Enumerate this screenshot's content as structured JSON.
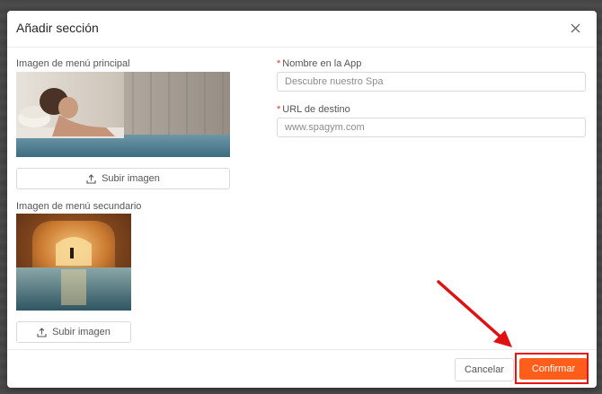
{
  "dialog": {
    "title": "Añadir sección"
  },
  "left": {
    "main_image_label": "Imagen de menú principal",
    "main_upload_label": "Subir imagen",
    "secondary_image_label": "Imagen de menú secundario",
    "secondary_upload_label": "Subir imagen"
  },
  "right": {
    "name_label": "Nombre en la App",
    "name_value": "Descubre nuestro Spa",
    "url_label": "URL de destino",
    "url_value": "www.spagym.com",
    "required_mark": "*"
  },
  "footer": {
    "cancel_label": "Cancelar",
    "confirm_label": "Confirmar"
  },
  "colors": {
    "accent": "#ff5e1a",
    "annotation": "#e11111"
  },
  "icons": [
    "close-icon",
    "upload-icon"
  ]
}
